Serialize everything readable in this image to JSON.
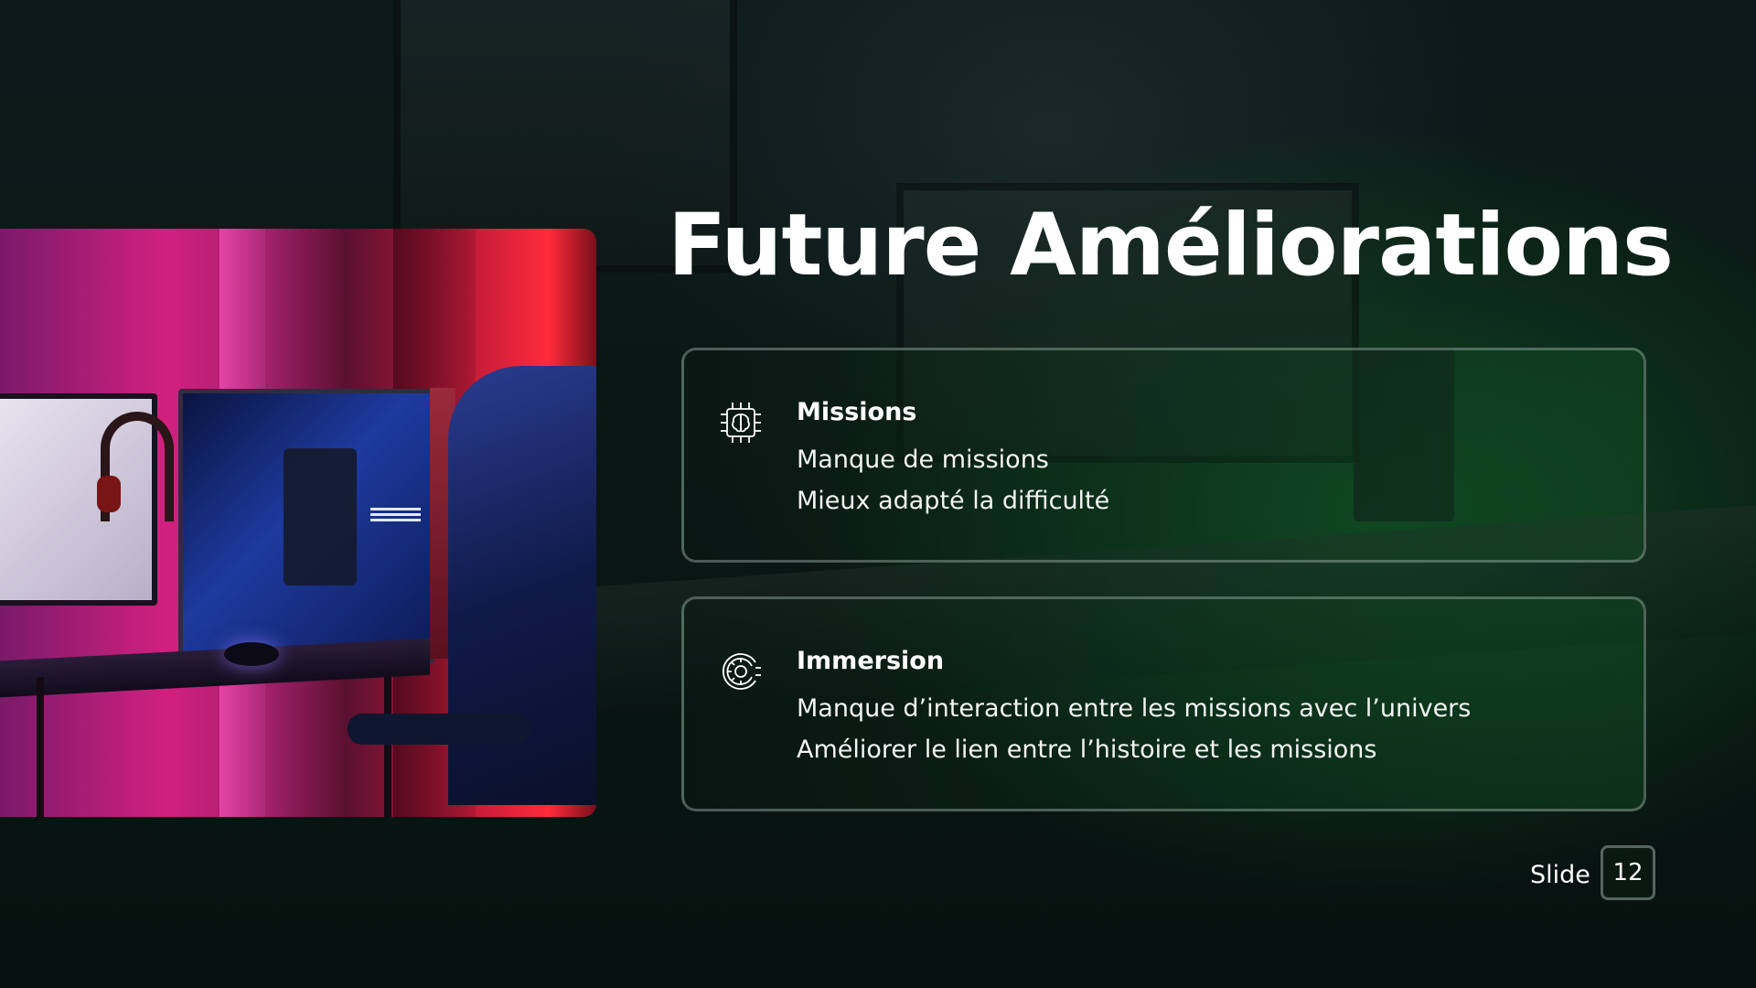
{
  "slide": {
    "title": "Future Améliorations",
    "cards": [
      {
        "icon": "brain-chip-icon",
        "heading": "Missions",
        "lines": [
          "Manque de missions",
          "Mieux adapté la difficulté"
        ]
      },
      {
        "icon": "gear-head-icon",
        "heading": "Immersion",
        "lines": [
          "Manque d’interaction entre les missions avec l’univers",
          "Améliorer le lien entre l’histoire et les missions"
        ]
      }
    ],
    "footer": {
      "label": "Slide",
      "number": "12"
    }
  },
  "colors": {
    "background": "#0a1714",
    "accent_green": "#146e2d",
    "text": "#ffffff"
  }
}
